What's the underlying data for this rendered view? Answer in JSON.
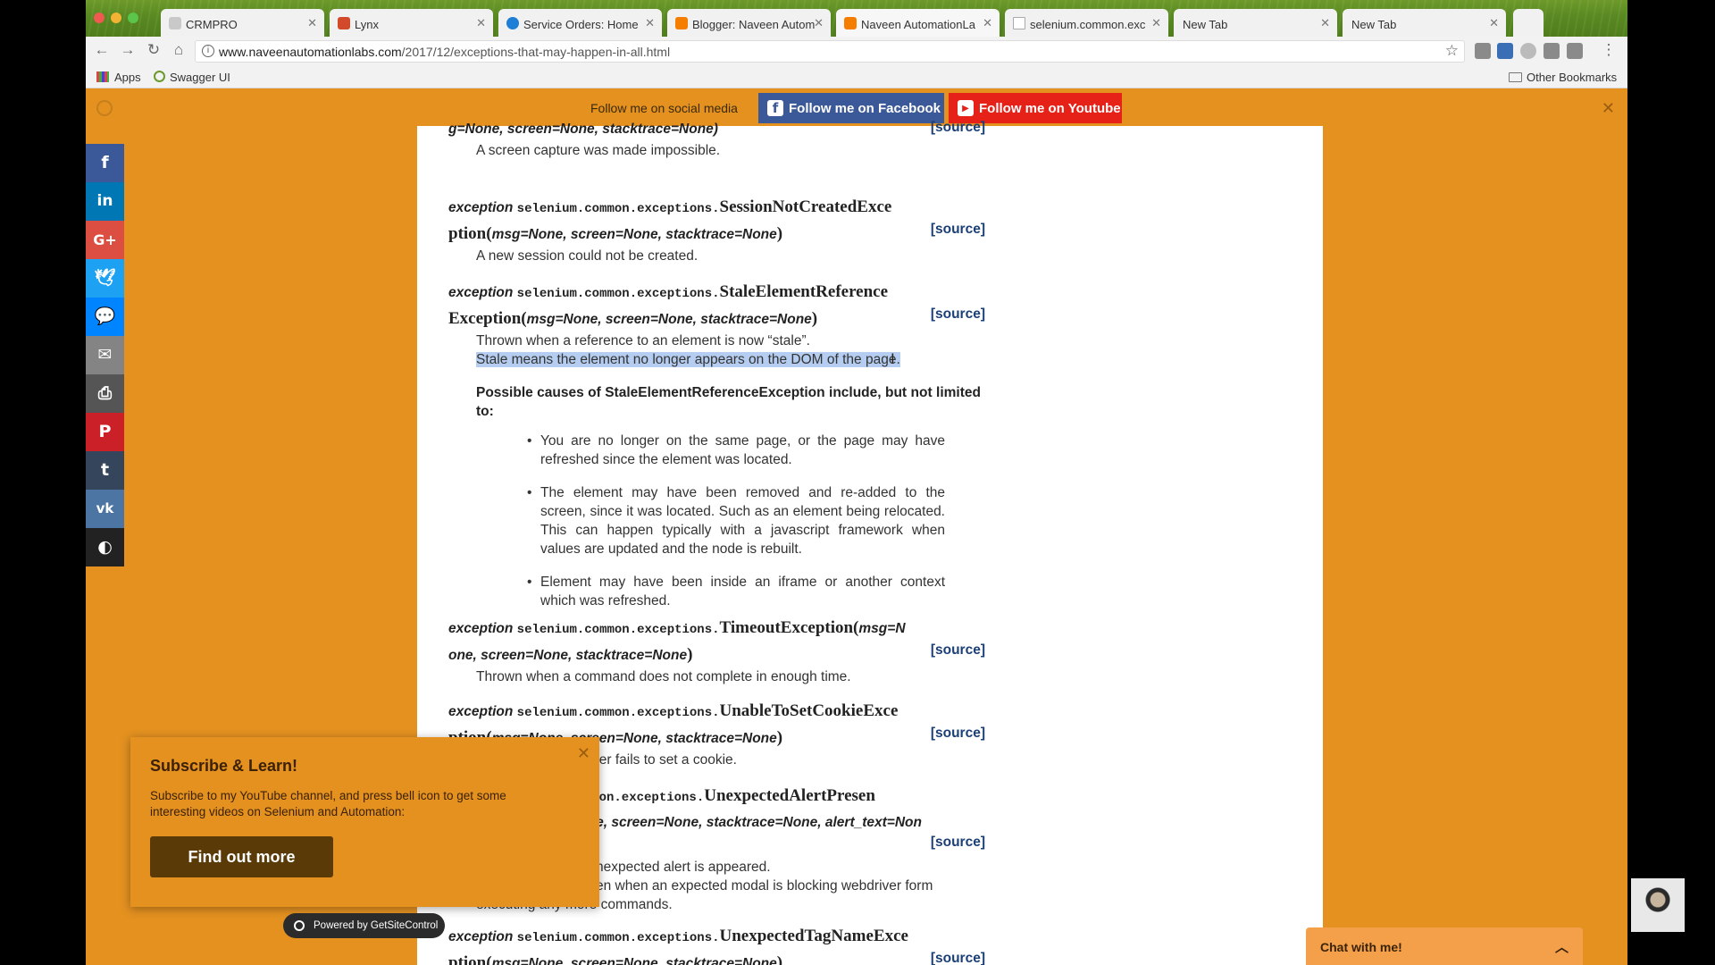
{
  "browser": {
    "tabs": [
      {
        "label": "CRMPRO"
      },
      {
        "label": "Lynx"
      },
      {
        "label": "Service Orders: Home"
      },
      {
        "label": "Blogger: Naveen Autom"
      },
      {
        "label": "Naveen AutomationLa"
      },
      {
        "label": "selenium.common.exc"
      },
      {
        "label": "New Tab"
      },
      {
        "label": "New Tab"
      }
    ],
    "url_host": "www.naveenautomationlabs.com",
    "url_path": "/2017/12/exceptions-that-may-happen-in-all.html",
    "bookmarks": {
      "apps": "Apps",
      "swagger": "Swagger UI",
      "other": "Other Bookmarks"
    }
  },
  "social_bar": {
    "message": "Follow me on social media",
    "facebook_label": "Follow me on Facebook",
    "youtube_label": "Follow me on Youtube"
  },
  "article": {
    "exceptions": [
      {
        "id": "screenshot",
        "sig_lines": [
          "g=None, screen=None, stacktrace=None)"
        ],
        "source_label": "[source]",
        "description": "A screen capture was made impossible."
      },
      {
        "id": "session",
        "prefix": "exception",
        "module": "selenium.common.exceptions.",
        "name1": "SessionNotCreatedExce",
        "name2": "ption(",
        "params": "msg=None, screen=None, stacktrace=None",
        "close": ")",
        "source_label": "[source]",
        "description": "A new session could not be created."
      },
      {
        "id": "stale",
        "prefix": "exception",
        "module": "selenium.common.exceptions.",
        "name1": "StaleElementReference",
        "name2": "Exception(",
        "params": "msg=None, screen=None, stacktrace=None",
        "close": ")",
        "source_label": "[source]",
        "description": "Thrown when a reference to an element is now “stale”.",
        "highlighted": "Stale means the element no longer appears on the DOM of the page.",
        "causes_title": "Possible causes of StaleElementReferenceException include, but not limited to:",
        "causes": [
          "You are no longer on the same page, or the page may have refreshed since the element was located.",
          "The element may have been removed and re-added to the screen, since it was located. Such as an element being relocated. This can happen typically with a javascript framework when values are updated and the node is rebuilt.",
          "Element may have been inside an iframe or another context which was refreshed."
        ]
      },
      {
        "id": "timeout",
        "prefix": "exception",
        "module": "selenium.common.exceptions.",
        "name1": "TimeoutException(",
        "params1": "msg=N",
        "params2": "one, screen=None, stacktrace=None",
        "close": ")",
        "source_label": "[source]",
        "description": "Thrown when a command does not complete in enough time."
      },
      {
        "id": "cookie",
        "prefix": "exception",
        "module": "selenium.common.exceptions.",
        "name1": "UnableToSetCookieExce",
        "name2": "ption(",
        "params": "msg=None, screen=None, stacktrace=None",
        "close": ")",
        "source_label": "[source]",
        "description": "ver fails to set a cookie."
      },
      {
        "id": "alert",
        "module": "common.exceptions.",
        "name1": "UnexpectedAlertPresen",
        "params": "None, screen=None, stacktrace=None, alert_text=Non",
        "source_label": "[source]",
        "description1": "nexpected alert is appeared.",
        "description2": "en when an expected modal is blocking webdriver form",
        "description3": "executing any more commands."
      },
      {
        "id": "tagname",
        "prefix": "exception",
        "module": "selenium.common.exceptions.",
        "name1": "UnexpectedTagNameExce",
        "name2": "ption(",
        "params": "msg=None, screen=None, stacktrace=None",
        "close": ")",
        "source_label": "[source]"
      }
    ]
  },
  "popup": {
    "title": "Subscribe & Learn!",
    "body": "Subscribe to my YouTube channel, and press bell icon to get some interesting videos on Selenium and Automation:",
    "cta": "Find out more",
    "powered": "Powered by GetSiteControl"
  },
  "chat": {
    "label": "Chat with me!"
  },
  "share_icons": [
    "facebook-icon",
    "linkedin-icon",
    "google-plus-icon",
    "twitter-icon",
    "messenger-icon",
    "email-icon",
    "print-icon",
    "pinterest-icon",
    "tumblr-icon",
    "vk-icon",
    "getsitecontrol-icon"
  ],
  "colors": {
    "page_bg": "#e49120",
    "facebook": "#3b5998",
    "youtube": "#e62117",
    "highlight": "#b4cdf0",
    "source_link": "#1b3f77"
  }
}
